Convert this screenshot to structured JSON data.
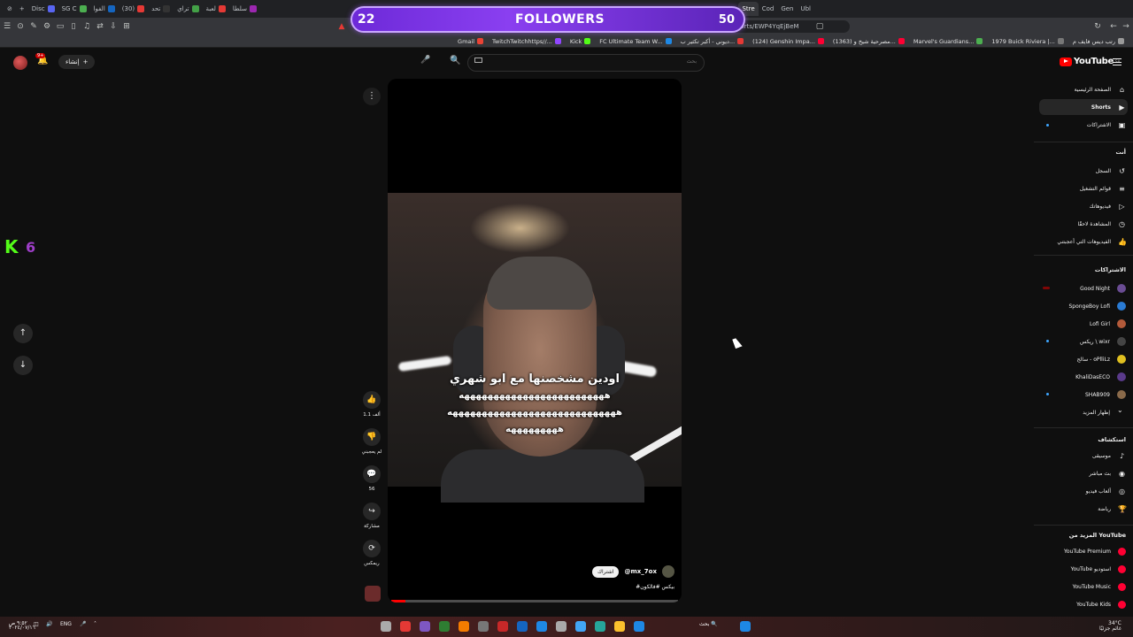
{
  "browser": {
    "tabs": [
      {
        "label": "Disc",
        "color": "#5865f2"
      },
      {
        "label": "SG C",
        "color": "#4caf50"
      },
      {
        "label": "الفوا",
        "color": "#1565c0"
      },
      {
        "label": "(30)",
        "color": "#e53935"
      },
      {
        "label": "تحد",
        "color": "#333333"
      },
      {
        "label": "تراي",
        "color": "#43a047"
      },
      {
        "label": "لعبة",
        "color": "#e53935"
      },
      {
        "label": "سلطا",
        "color": "#9c27b0"
      }
    ],
    "right_tabs": [
      "Stre",
      "Cod",
      "Gen",
      "Ubl"
    ],
    "url": "youtube.com/shorts/EWP4YqEjBeM"
  },
  "bookmarks": [
    {
      "label": "Gmail",
      "color": "#ea4335"
    },
    {
      "label": "TwitchTwitchhttps//...",
      "color": "#9146ff"
    },
    {
      "label": "Kick",
      "color": "#53fc18"
    },
    {
      "label": "FC Ultimate Team W...",
      "color": "#1e88e5"
    },
    {
      "label": "ديوني - أكبر تكثير ب...",
      "color": "#e53935"
    },
    {
      "label": "(124) Genshin Impa...",
      "color": "#ff0033"
    },
    {
      "label": "(1363) مصرحية شيخ و...",
      "color": "#ff0033"
    },
    {
      "label": "Marvel's Guardians...",
      "color": "#4caf50"
    },
    {
      "label": "1979 Buick Riviera |...",
      "color": "#777777"
    },
    {
      "label": "رتب ديس فايف م",
      "color": "#999999"
    }
  ],
  "followers_widget": {
    "current": "22",
    "title": "FOLLOWERS",
    "goal": "50",
    "progress": 0.44
  },
  "youtube": {
    "create_label": "إنشاء",
    "notification_count": "9+",
    "search_placeholder": "بحث",
    "logo_text": "YouTube",
    "logo_country": "SA"
  },
  "short": {
    "caption_line1": "اودين مشخصنها مع ابو شهري",
    "caption_line2": "هههههههههههههههههههههههههه",
    "caption_line3": "هههههههههههههههههههههههههههههه",
    "caption_line4": "هههههههههه",
    "channel": "@mx_7ox",
    "subscribe": "اشتراك",
    "hashtag": "#بيكس #فالكون",
    "progress": 0.05,
    "actions": [
      {
        "icon": "like-icon",
        "glyph": "👍",
        "label": "1.1 ألف"
      },
      {
        "icon": "dislike-icon",
        "glyph": "👎",
        "label": "لم يعجبني"
      },
      {
        "icon": "comment-icon",
        "glyph": "💬",
        "label": "56"
      },
      {
        "icon": "share-icon",
        "glyph": "↪",
        "label": "مشاركة"
      },
      {
        "icon": "remix-icon",
        "glyph": "⟳",
        "label": "ريمكس"
      }
    ]
  },
  "kick_overlay": {
    "count": "6"
  },
  "sidebar": {
    "main": [
      {
        "label": "الصفحة الرئيسية",
        "icon": "home-icon",
        "glyph": "⌂"
      },
      {
        "label": "Shorts",
        "icon": "shorts-icon",
        "glyph": "▶"
      },
      {
        "label": "الاشتراكات",
        "icon": "subscriptions-icon",
        "glyph": "▣"
      }
    ],
    "you_header": "أنت",
    "you": [
      {
        "label": "السجل",
        "icon": "history-icon",
        "glyph": "↺"
      },
      {
        "label": "قوائم التشغيل",
        "icon": "playlists-icon",
        "glyph": "≡"
      },
      {
        "label": "فيديوهاتك",
        "icon": "your-videos-icon",
        "glyph": "▷"
      },
      {
        "label": "المشاهدة لاحقًا",
        "icon": "watch-later-icon",
        "glyph": "◷"
      },
      {
        "label": "الفيديوهات التي أعجبتني",
        "icon": "liked-icon",
        "glyph": "👍"
      }
    ],
    "subs_header": "الاشتراكات",
    "subs": [
      {
        "label": "Good Night",
        "color": "#6a4c93"
      },
      {
        "label": "SpongeBoy Lofi",
        "color": "#2a7bd4"
      },
      {
        "label": "Lofi Girl",
        "color": "#b35a3a"
      },
      {
        "label": "ريكس \\ wixr",
        "color": "#444444"
      },
      {
        "label": "سالح - oPlliLz",
        "color": "#e0c020"
      },
      {
        "label": "KhaliDasECO",
        "color": "#5a3a8a"
      },
      {
        "label": "SHAB909",
        "color": "#8a6a4a"
      },
      {
        "label": "إظهار المزيد",
        "color": ""
      }
    ],
    "explore_header": "استكشاف",
    "explore": [
      {
        "label": "موسيقى",
        "icon": "music-icon",
        "glyph": "♪"
      },
      {
        "label": "بث مباشر",
        "icon": "live-icon",
        "glyph": "◉"
      },
      {
        "label": "ألعاب فيديو",
        "icon": "gaming-icon",
        "glyph": "◎"
      },
      {
        "label": "رياضة",
        "icon": "sports-icon",
        "glyph": "🏆"
      }
    ],
    "more_header": "المزيد من YouTube",
    "more": [
      {
        "label": "YouTube Premium"
      },
      {
        "label": "YouTube استوديو"
      },
      {
        "label": "YouTube Music"
      },
      {
        "label": "YouTube Kids"
      }
    ]
  },
  "taskbar": {
    "weather": "34°C",
    "weather_sub": "غائم جزئيًا",
    "lang": "ENG",
    "time": "٩:٥٢ ص",
    "date": "٢٠٢٤/٠٧/١٦",
    "search_label": "بحث"
  }
}
